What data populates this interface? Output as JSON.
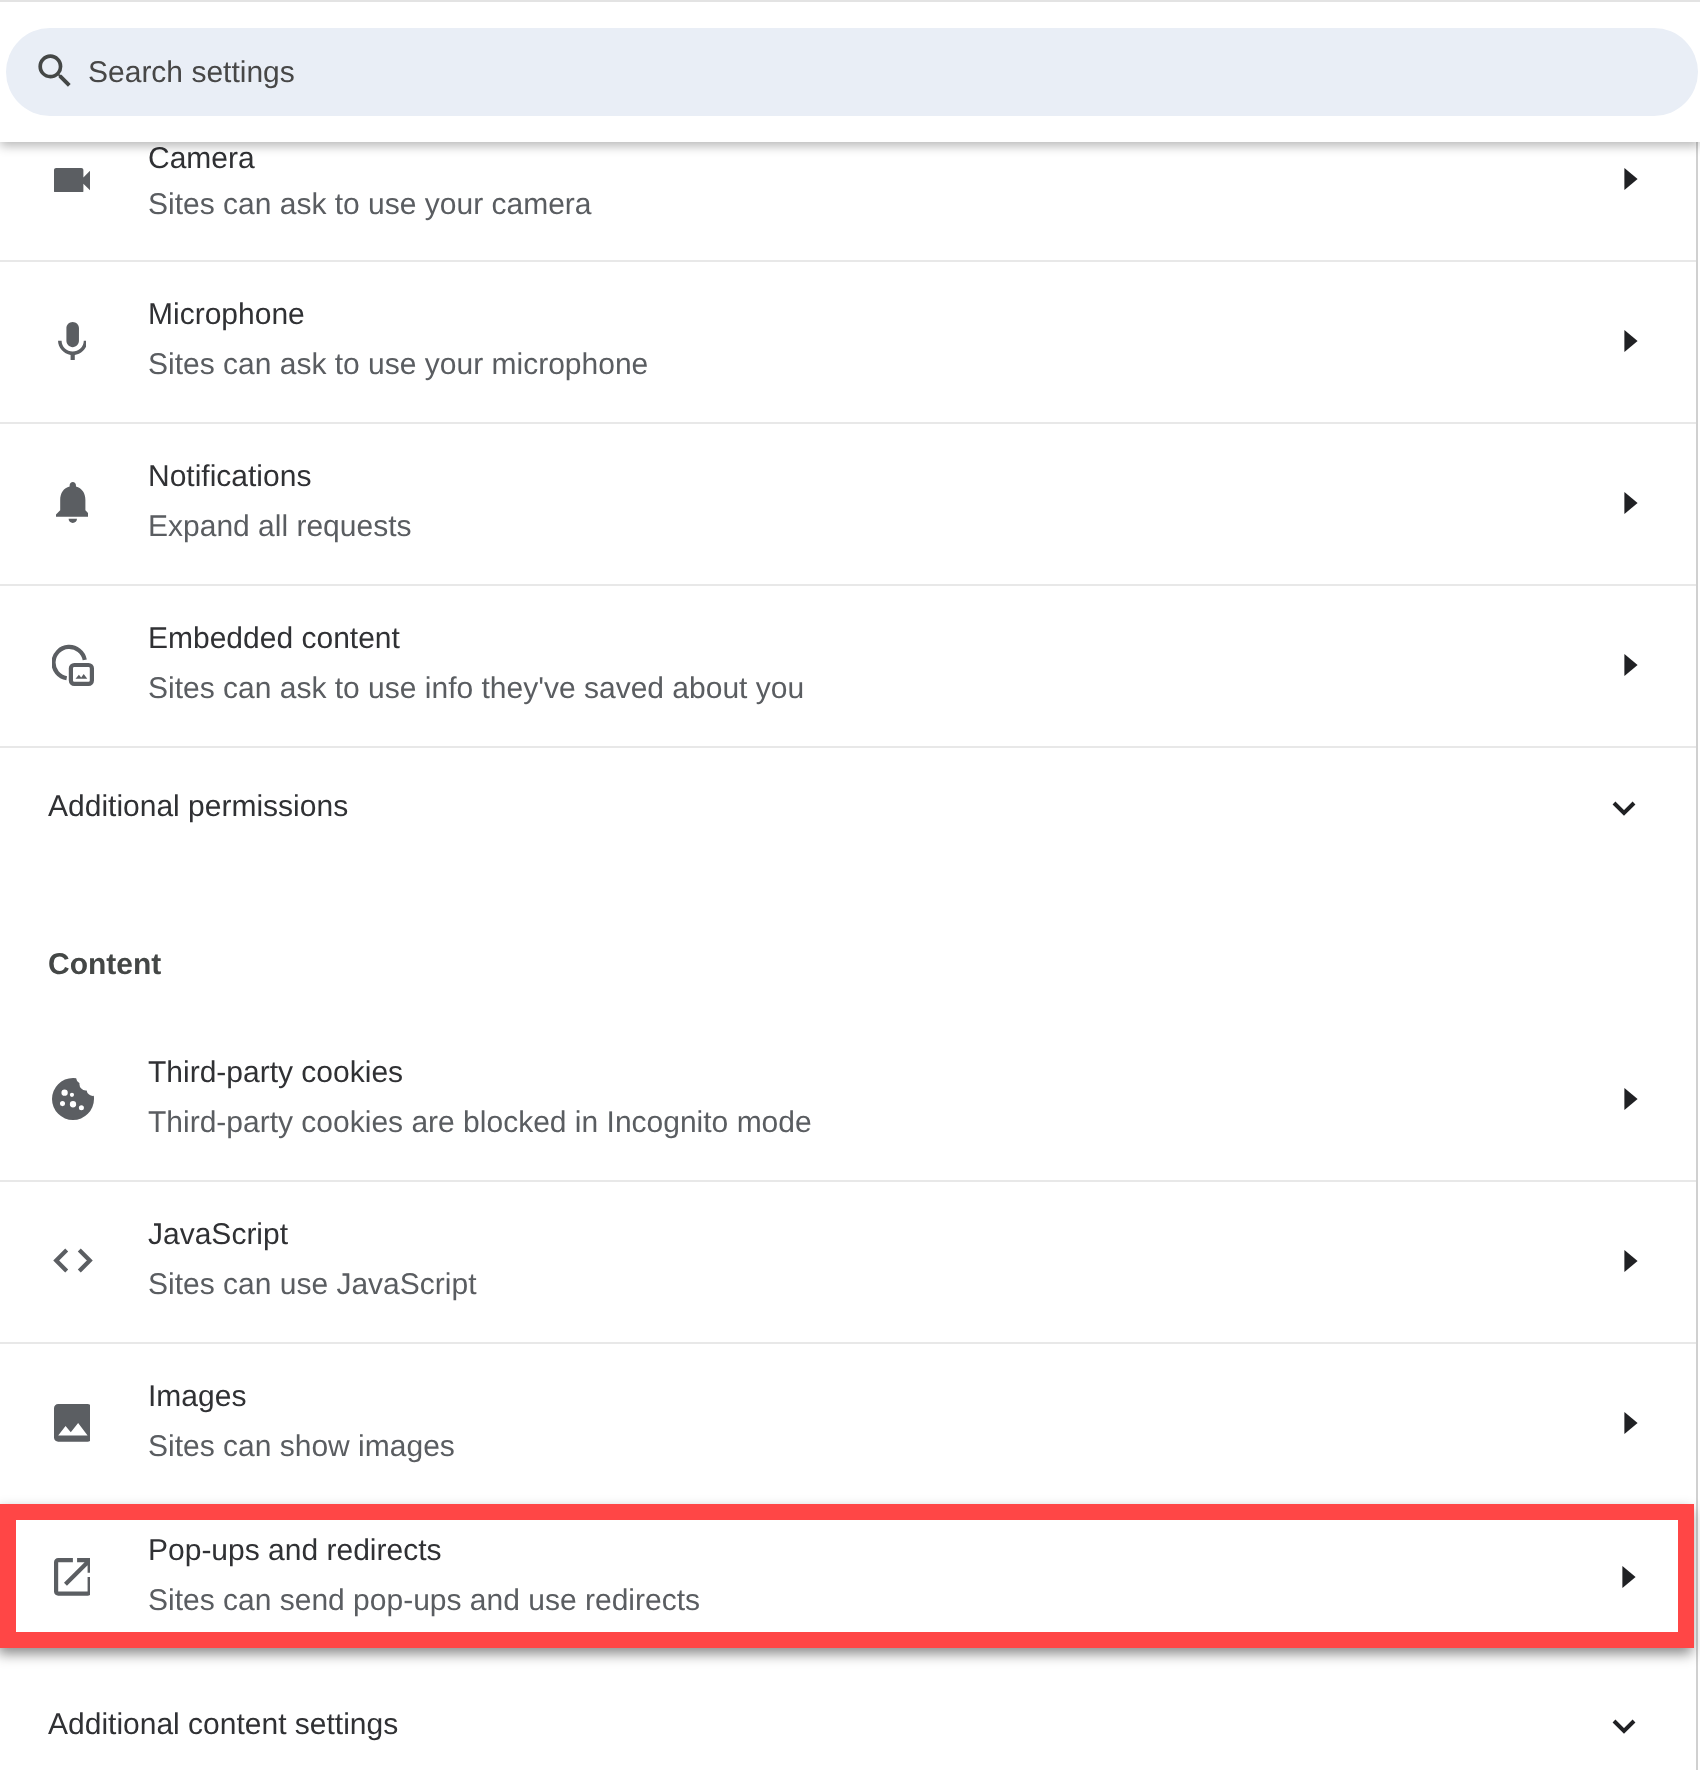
{
  "search": {
    "placeholder": "Search settings"
  },
  "permissions": {
    "items": [
      {
        "title": "Camera",
        "description": "Sites can ask to use your camera",
        "highlighted": false
      },
      {
        "title": "Microphone",
        "description": "Sites can ask to use your microphone",
        "highlighted": false
      },
      {
        "title": "Notifications",
        "description": "Expand all requests",
        "highlighted": false
      },
      {
        "title": "Embedded content",
        "description": "Sites can ask to use info they've saved about you",
        "highlighted": false
      }
    ],
    "more": {
      "label": "Additional permissions",
      "expanded": false
    }
  },
  "content": {
    "heading": "Content",
    "items": [
      {
        "title": "Third-party cookies",
        "description": "Third-party cookies are blocked in Incognito mode",
        "highlighted": false
      },
      {
        "title": "JavaScript",
        "description": "Sites can use JavaScript",
        "highlighted": false
      },
      {
        "title": "Images",
        "description": "Sites can show images",
        "highlighted": false
      },
      {
        "title": "Pop-ups and redirects",
        "description": "Sites can send pop-ups and use redirects",
        "highlighted": true
      }
    ],
    "more": {
      "label": "Additional content settings",
      "expanded": false
    }
  }
}
